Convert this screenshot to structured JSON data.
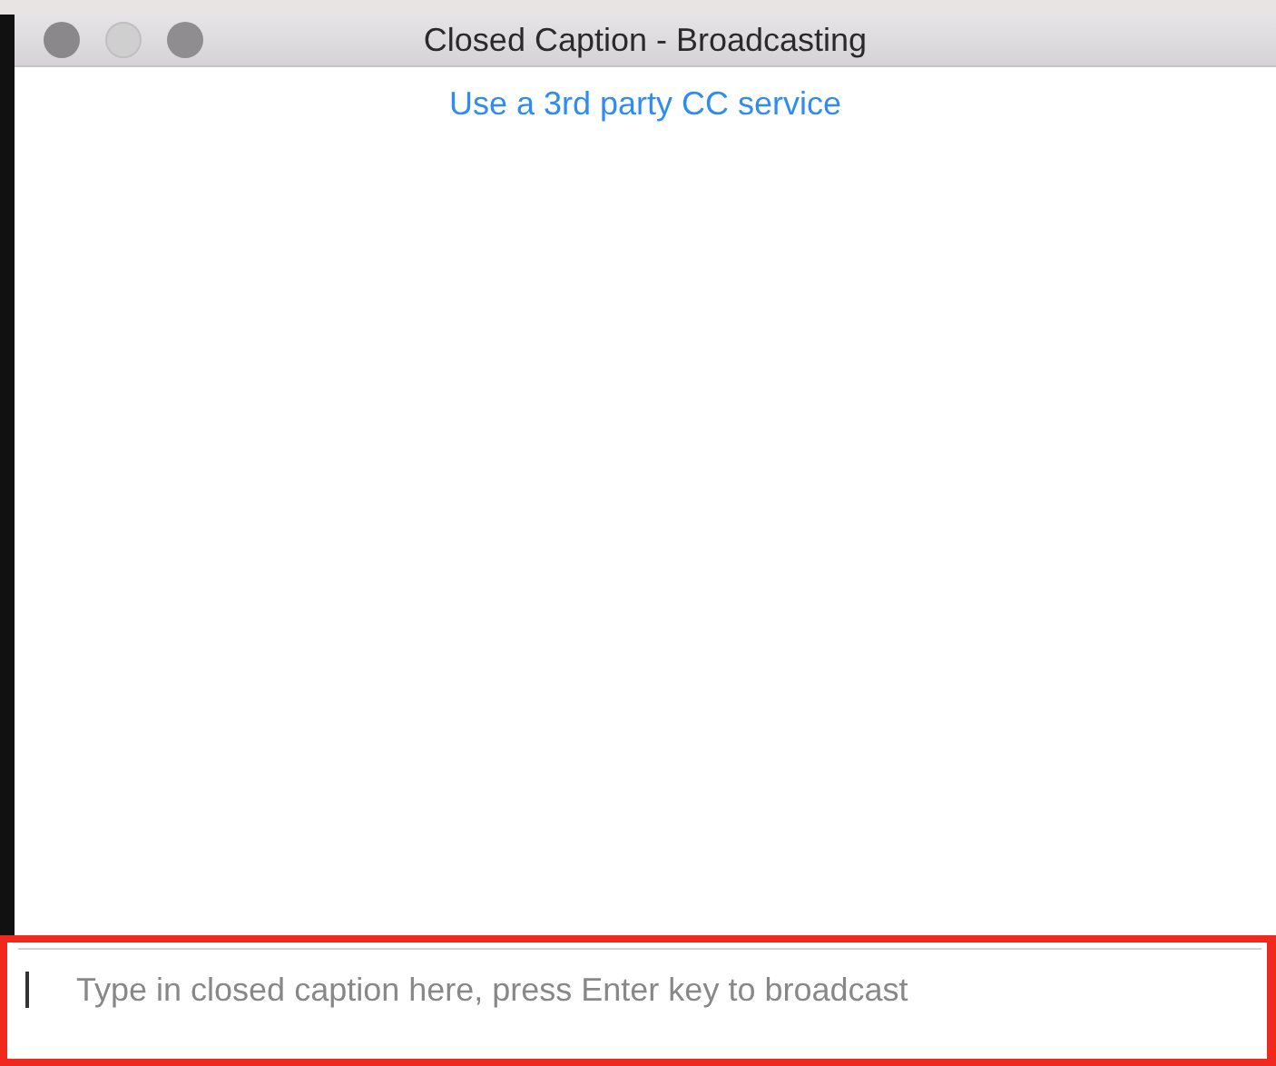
{
  "window": {
    "title": "Closed Caption - Broadcasting"
  },
  "link": "Use a 3rd party CC service",
  "caption_input": {
    "placeholder": "Type in closed caption here, press Enter key to broadcast"
  }
}
